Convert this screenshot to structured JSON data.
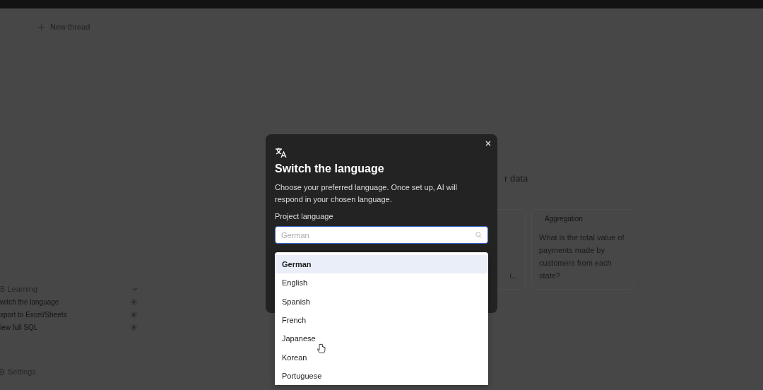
{
  "sidebar": {
    "new_thread": "New thread",
    "section": {
      "title": "B Learning",
      "expanded": true,
      "items": [
        "witch the language",
        "xport to Excel/Sheets",
        "iew full SQL"
      ]
    },
    "settings": "Settings"
  },
  "main": {
    "heading": "r data",
    "cards": [
      {
        "text": "i..."
      },
      {
        "tag": "Aggregation",
        "text": "What is the total value of payments made by customers from each state?"
      }
    ]
  },
  "dialog": {
    "title": "Switch the language",
    "description": "Choose your preferred language. Once set up, AI will respond in your chosen language.",
    "field_label": "Project language",
    "search": {
      "placeholder": "German"
    },
    "options": [
      {
        "label": "German",
        "selected": true
      },
      {
        "label": "English",
        "selected": false
      },
      {
        "label": "Spanish",
        "selected": false
      },
      {
        "label": "French",
        "selected": false
      },
      {
        "label": "Japanese",
        "selected": false
      },
      {
        "label": "Korean",
        "selected": false
      },
      {
        "label": "Portuguese",
        "selected": false
      }
    ]
  }
}
